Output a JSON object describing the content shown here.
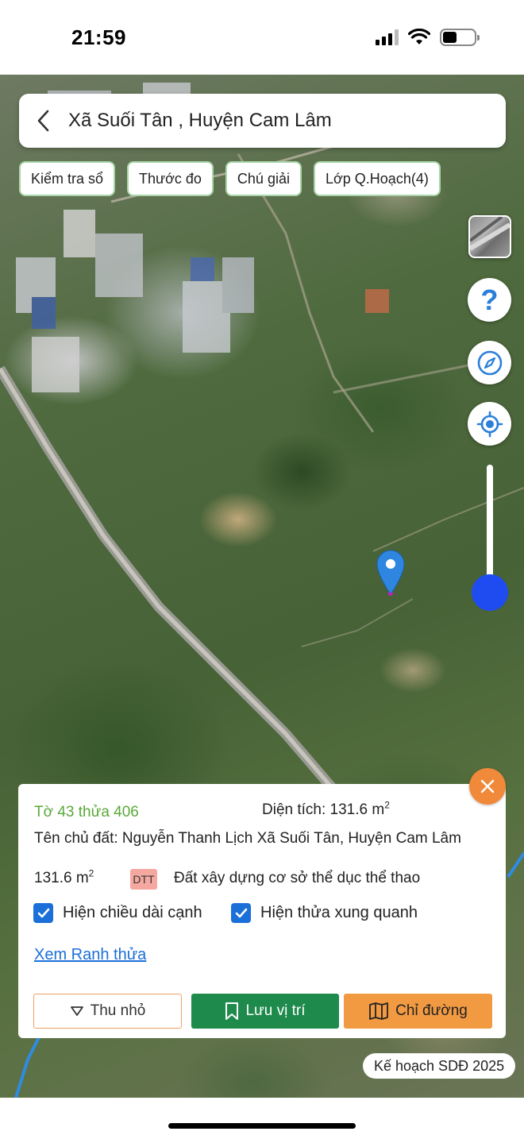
{
  "status_bar": {
    "time": "21:59",
    "icons": [
      "cellular-signal-icon",
      "wifi-icon",
      "battery-icon"
    ],
    "battery_level": 0.35
  },
  "header": {
    "back_icon": "chevron-left-icon",
    "title": "Xã Suối Tân , Huyện Cam Lâm"
  },
  "toolbar": {
    "chips": [
      "Kiểm tra sổ",
      "Thước đo",
      "Chú giải",
      "Lớp Q.Hoạch(4)"
    ]
  },
  "map_controls": {
    "layer_icon": "satellite-layer-icon",
    "help_label": "?",
    "compass_icon": "compass-icon",
    "locate_icon": "crosshair-locate-icon",
    "zoom_level_fraction": 0.9
  },
  "info_panel": {
    "parcel_id": "Tờ 43 thửa 406",
    "area_label": "Diện tích: 131.6 m",
    "area_unit_sup": "2",
    "owner": "Tên chủ đất: Nguyễn Thanh Lịch Xã Suối Tân, Huyện Cam Lâm",
    "area_value": "131.6 m",
    "area_value_sup": "2",
    "land_code": "DTT",
    "land_use": "Đất xây dựng cơ sở thể dục thể thao",
    "checkbox_edges": "Hiện chiều dài cạnh",
    "checkbox_neighbors": "Hiện thửa xung quanh",
    "checkbox_edges_checked": true,
    "checkbox_neighbors_checked": true,
    "link_boundary": "Xem Ranh thửa",
    "btn_minimize": "Thu nhỏ",
    "btn_save": "Lưu vị trí",
    "btn_route": "Chỉ đường"
  },
  "plan_tag": "Kế hoạch SDĐ 2025",
  "colors": {
    "accent_green": "#1e8a4c",
    "accent_orange": "#f29a42",
    "link_blue": "#1b6fd9",
    "parcel_green": "#5aa83a",
    "zoom_blue": "#1f4cf0",
    "marker_blue": "#2f86e0"
  }
}
